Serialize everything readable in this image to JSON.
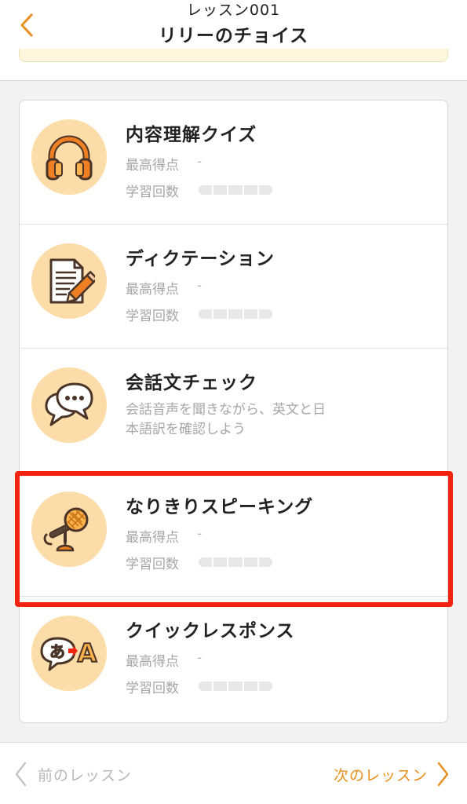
{
  "header": {
    "subtitle": "レッスン001",
    "title": "リリーのチョイス",
    "back_icon": "chevron-left-icon"
  },
  "colors": {
    "accent": "#e8901f",
    "icon_bg": "#fcdca8",
    "highlight": "#f4230f"
  },
  "items": [
    {
      "title": "内容理解クイズ",
      "icon": "headphones-icon",
      "best_label": "最高得点",
      "best_value": "-",
      "count_label": "学習回数",
      "progress": 0
    },
    {
      "title": "ディクテーション",
      "icon": "pencil-document-icon",
      "best_label": "最高得点",
      "best_value": "-",
      "count_label": "学習回数",
      "progress": 0
    },
    {
      "title": "会話文チェック",
      "icon": "speech-bubbles-icon",
      "desc_line1": "会話音声を聞きながら、英文と日",
      "desc_line2": "本語訳を確認しよう"
    },
    {
      "title": "なりきりスピーキング",
      "icon": "microphone-icon",
      "best_label": "最高得点",
      "best_value": "-",
      "count_label": "学習回数",
      "progress": 0
    },
    {
      "title": "クイックレスポンス",
      "icon": "translate-icon",
      "icon_text_from": "あ",
      "icon_text_to": "A",
      "best_label": "最高得点",
      "best_value": "-",
      "count_label": "学習回数",
      "progress": 0
    }
  ],
  "footer": {
    "prev_label": "前のレッスン",
    "next_label": "次のレッスン"
  }
}
